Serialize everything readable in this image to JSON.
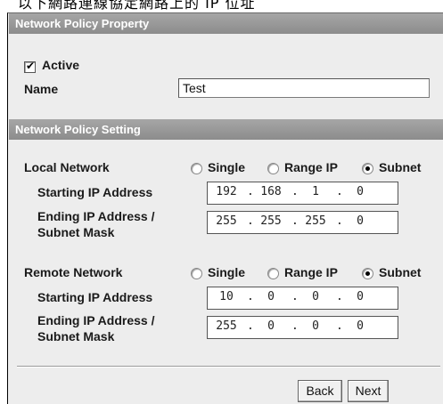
{
  "caption": "以下網路連線協定網路上的 IP 位址",
  "property": {
    "header": "Network Policy Property",
    "active_label": "Active",
    "active_checked": true,
    "name_label": "Name",
    "name_value": "Test"
  },
  "setting": {
    "header": "Network Policy Setting",
    "local": {
      "label": "Local Network",
      "options": [
        "Single",
        "Range IP",
        "Subnet"
      ],
      "selected": "Subnet",
      "start_label": "Starting IP Address",
      "start_ip": [
        "192",
        "168",
        "1",
        "0"
      ],
      "end_label_line1": "Ending IP Address /",
      "end_label_line2": "Subnet Mask",
      "end_ip": [
        "255",
        "255",
        "255",
        "0"
      ]
    },
    "remote": {
      "label": "Remote Network",
      "options": [
        "Single",
        "Range IP",
        "Subnet"
      ],
      "selected": "Subnet",
      "start_label": "Starting IP Address",
      "start_ip": [
        "10",
        "0",
        "0",
        "0"
      ],
      "end_label_line1": "Ending IP Address /",
      "end_label_line2": "Subnet Mask",
      "end_ip": [
        "255",
        "0",
        "0",
        "0"
      ]
    }
  },
  "buttons": {
    "back": "Back",
    "next": "Next"
  }
}
